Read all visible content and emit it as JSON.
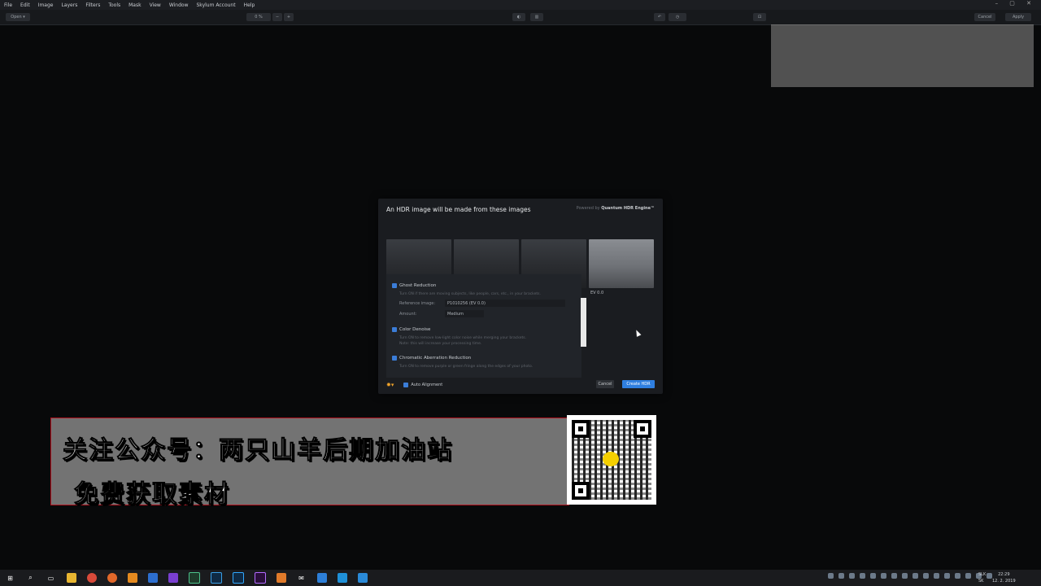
{
  "menu": [
    "File",
    "Edit",
    "Image",
    "Layers",
    "Filters",
    "Tools",
    "Mask",
    "View",
    "Window",
    "Skylum Account",
    "Help"
  ],
  "toolbar": {
    "open_label": "Open ▾",
    "zoom_label": "0 %",
    "zoom_out": "−",
    "zoom_in": "+",
    "cancel_label": "Cancel",
    "apply_label": "Apply"
  },
  "dialog": {
    "title": "An HDR image will be made from these images",
    "powered_prefix": "Powered by",
    "powered_brand": "Quantum HDR Engine™",
    "ev_label": "EV 0.0",
    "ghost": {
      "label": "Ghost Reduction",
      "desc": "Turn ON if there are moving subjects, like people, cars, etc., in your brackets.",
      "ref_label": "Reference image:",
      "ref_value": "P1010256 (EV 0.0)",
      "amount_label": "Amount:",
      "amount_value": "Medium"
    },
    "denoise": {
      "label": "Color Denoise",
      "desc1": "Turn ON to remove low-light color noise while merging your brackets.",
      "desc2": "Note: this will increase your processing time."
    },
    "chroma": {
      "label": "Chromatic Aberration Reduction",
      "desc": "Turn ON to remove purple or green fringe along the edges of your photo."
    },
    "auto_alignment": "Auto Alignment",
    "cancel": "Cancel",
    "create": "Create HDR"
  },
  "banner": {
    "line1": "关注公众号：两只山羊后期加油站",
    "line2": "免费获取素材"
  },
  "taskbar": {
    "lang_top": "SLK",
    "lang_bottom": "SK",
    "time": "22:29",
    "date": "12. 2. 2019"
  }
}
